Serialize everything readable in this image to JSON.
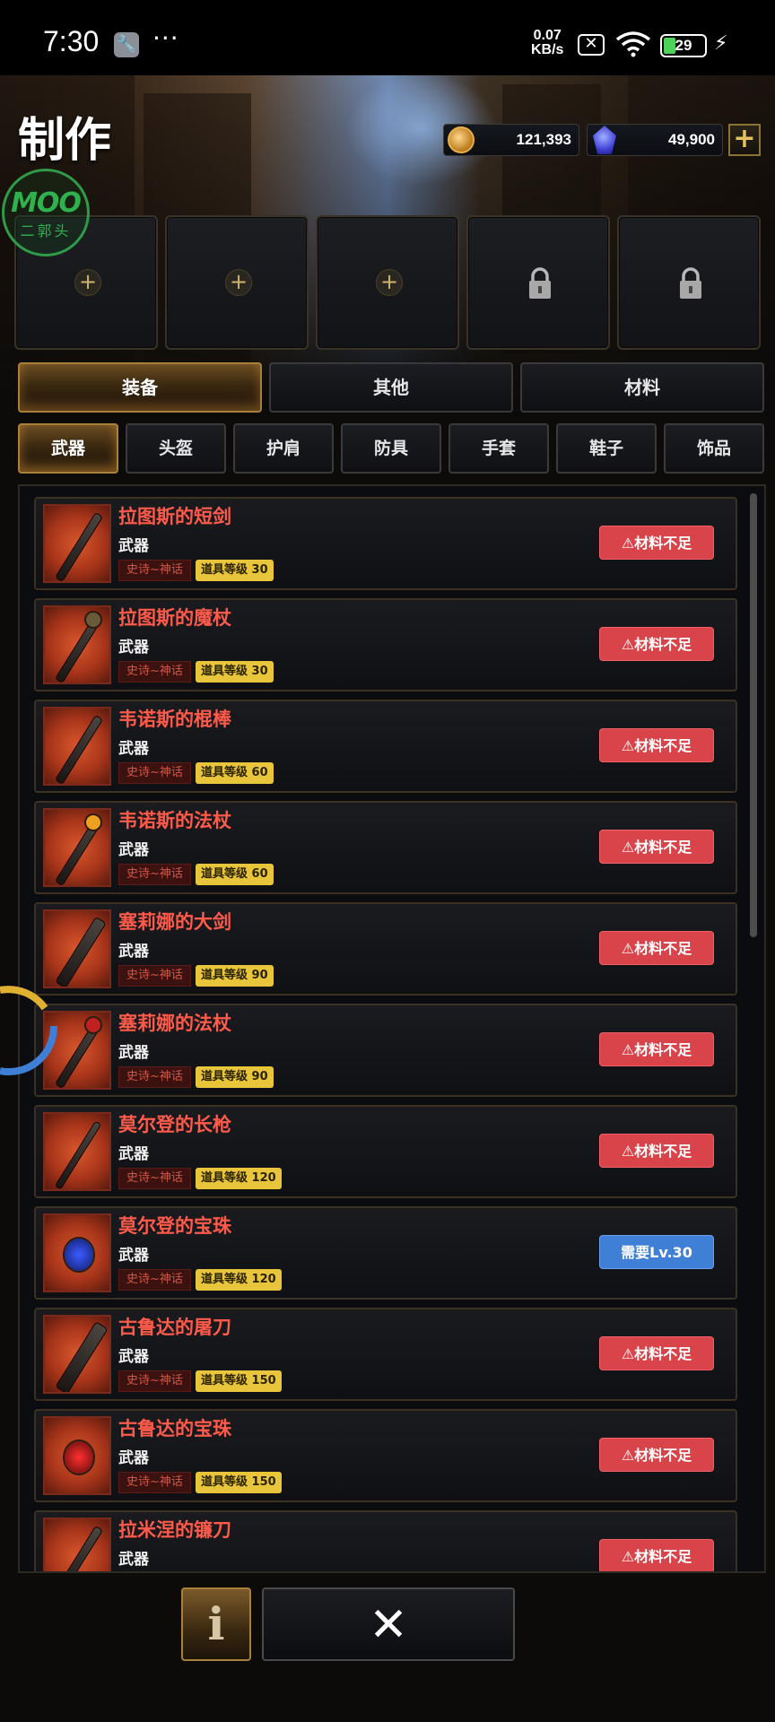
{
  "status_bar": {
    "time": "7:30",
    "net_speed_value": "0.07",
    "net_speed_unit": "KB/s",
    "battery": "29",
    "icons": [
      "wrench-icon",
      "more-dots-icon",
      "no-sim-icon",
      "wifi-icon",
      "battery-icon",
      "charging-bolt-icon"
    ]
  },
  "header": {
    "title": "制作",
    "watermark_top": "MOO",
    "watermark_bottom": "二郭头",
    "gold": "121,393",
    "gems": "49,900"
  },
  "slots": [
    {
      "state": "empty",
      "icon": "plus-icon"
    },
    {
      "state": "empty",
      "icon": "plus-icon"
    },
    {
      "state": "empty",
      "icon": "plus-icon"
    },
    {
      "state": "locked",
      "icon": "lock-icon"
    },
    {
      "state": "locked",
      "icon": "lock-icon"
    }
  ],
  "tabs": [
    "装备",
    "其他",
    "材料"
  ],
  "active_tab": 0,
  "subtabs": [
    "武器",
    "头盔",
    "护肩",
    "防具",
    "手套",
    "鞋子",
    "饰品"
  ],
  "active_subtab": 0,
  "items": [
    {
      "name": "拉图斯的短剑",
      "type": "武器",
      "rarity": "史诗~神话",
      "level": "道具等级 30",
      "button": "⚠材料不足",
      "button_style": "red"
    },
    {
      "name": "拉图斯的魔杖",
      "type": "武器",
      "rarity": "史诗~神话",
      "level": "道具等级 30",
      "button": "⚠材料不足",
      "button_style": "red"
    },
    {
      "name": "韦诺斯的棍棒",
      "type": "武器",
      "rarity": "史诗~神话",
      "level": "道具等级 60",
      "button": "⚠材料不足",
      "button_style": "red"
    },
    {
      "name": "韦诺斯的法杖",
      "type": "武器",
      "rarity": "史诗~神话",
      "level": "道具等级 60",
      "button": "⚠材料不足",
      "button_style": "red"
    },
    {
      "name": "塞莉娜的大剑",
      "type": "武器",
      "rarity": "史诗~神话",
      "level": "道具等级 90",
      "button": "⚠材料不足",
      "button_style": "red"
    },
    {
      "name": "塞莉娜的法杖",
      "type": "武器",
      "rarity": "史诗~神话",
      "level": "道具等级 90",
      "button": "⚠材料不足",
      "button_style": "red"
    },
    {
      "name": "莫尔登的长枪",
      "type": "武器",
      "rarity": "史诗~神话",
      "level": "道具等级 120",
      "button": "⚠材料不足",
      "button_style": "red"
    },
    {
      "name": "莫尔登的宝珠",
      "type": "武器",
      "rarity": "史诗~神话",
      "level": "道具等级 120",
      "button": "需要Lv.30",
      "button_style": "blue"
    },
    {
      "name": "古鲁达的屠刀",
      "type": "武器",
      "rarity": "史诗~神话",
      "level": "道具等级 150",
      "button": "⚠材料不足",
      "button_style": "red"
    },
    {
      "name": "古鲁达的宝珠",
      "type": "武器",
      "rarity": "史诗~神话",
      "level": "道具等级 150",
      "button": "⚠材料不足",
      "button_style": "red"
    },
    {
      "name": "拉米涅的镰刀",
      "type": "武器",
      "rarity": "",
      "level": "",
      "button": "⚠材料不足",
      "button_style": "red"
    }
  ],
  "bottom": {
    "info_label": "i",
    "close_label": "✕"
  },
  "colors": {
    "item_name": "#ff5a4a",
    "button_red": "#d8444a",
    "button_blue": "#3f7fd6",
    "level_badge": "#e8c53a",
    "gold_accent": "#a8803a"
  }
}
